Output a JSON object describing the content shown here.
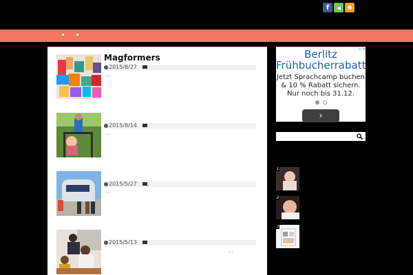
{
  "colors": {
    "background": "#000000",
    "nav": "#f47560",
    "facebook": "#3b5998",
    "feedly": "#6cc655",
    "rss": "#f39c12"
  },
  "social": [
    {
      "name": "facebook-icon",
      "glyph": "f"
    },
    {
      "name": "feedly-icon",
      "glyph": "◀"
    },
    {
      "name": "rss-icon",
      "glyph": "◉"
    }
  ],
  "posts": [
    {
      "title": "Magformers",
      "date": "2015/8/27",
      "excerpt": "..."
    },
    {
      "title": "",
      "date": "2015/8/14",
      "excerpt": "..."
    },
    {
      "title": "",
      "date": "2015/5/27",
      "category_sep": ",",
      "excerpt": "..."
    },
    {
      "title": "",
      "date": "2015/5/13",
      "excerpt": "..."
    }
  ],
  "ad": {
    "title_line1": "Berlitz",
    "title_line2": "Frühbucherrabatt",
    "line1": "Jetzt Sprachcamp buchen",
    "line2": "& 10 % Rabatt sichern.",
    "line3": "Nur noch bis 31.12.",
    "button": "›"
  },
  "search": {
    "placeholder": ""
  },
  "sidebar_posts": [
    {
      "rank": "1"
    },
    {
      "rank": "2"
    },
    {
      "rank": "3"
    }
  ]
}
